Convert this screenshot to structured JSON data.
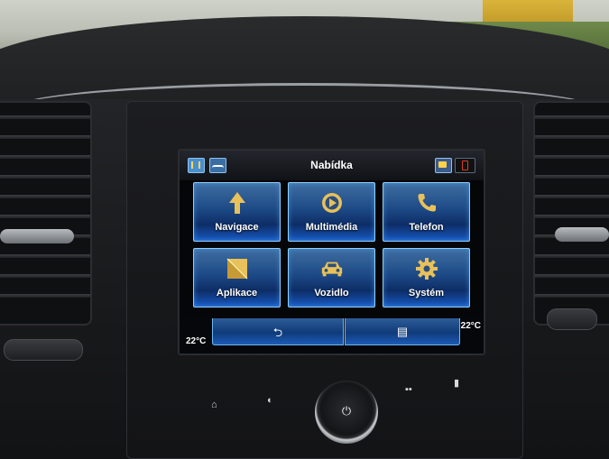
{
  "screen": {
    "title": "Nabídka",
    "tiles": [
      {
        "label": "Navigace",
        "icon": "navigation-arrow-icon"
      },
      {
        "label": "Multimédia",
        "icon": "media-play-icon"
      },
      {
        "label": "Telefon",
        "icon": "phone-icon"
      },
      {
        "label": "Aplikace",
        "icon": "apps-envelope-icon"
      },
      {
        "label": "Vozidlo",
        "icon": "car-icon"
      },
      {
        "label": "Systém",
        "icon": "gear-icon"
      }
    ],
    "temp_left": "22°C",
    "temp_right": "22°C",
    "back_glyph": "⮌",
    "list_glyph": "▤"
  },
  "physical_buttons": {
    "home_glyph": "⌂",
    "brightness_glyph": "◐",
    "voice_glyph": "▪•",
    "phone_glyph": "▮",
    "power_glyph": "⏻"
  },
  "colors": {
    "tile_border": "#8fd0ff",
    "tile_blue": "#1d4a86",
    "icon_gold": "#e8c15a"
  }
}
